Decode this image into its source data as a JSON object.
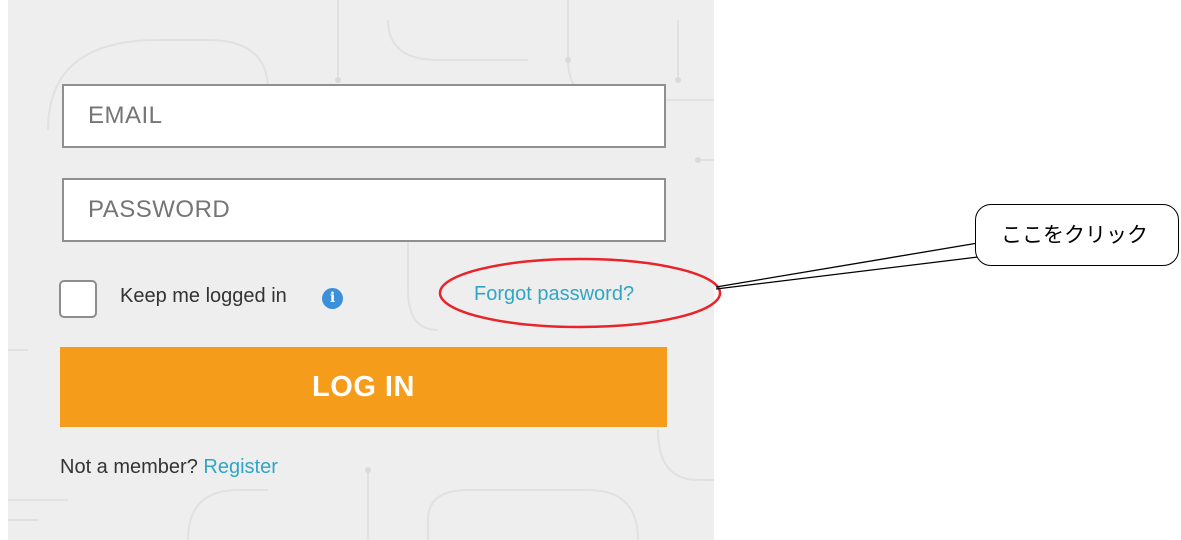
{
  "login_form": {
    "email_placeholder": "EMAIL",
    "password_placeholder": "PASSWORD",
    "remember_label": "Keep me logged in",
    "remember_checked": false,
    "info_icon": "info-icon",
    "forgot_password": "Forgot password?",
    "login_button": "LOG IN",
    "register_prompt": "Not a member?",
    "register_link": "Register"
  },
  "annotation": {
    "callout_text": "ここをクリック",
    "ellipse_color": "#e8232a",
    "line_color": "#000000"
  },
  "colors": {
    "panel_background": "#eeeeee",
    "accent_orange": "#f59c1a",
    "link_teal": "#31a6c4",
    "info_blue": "#3d8fd9"
  }
}
